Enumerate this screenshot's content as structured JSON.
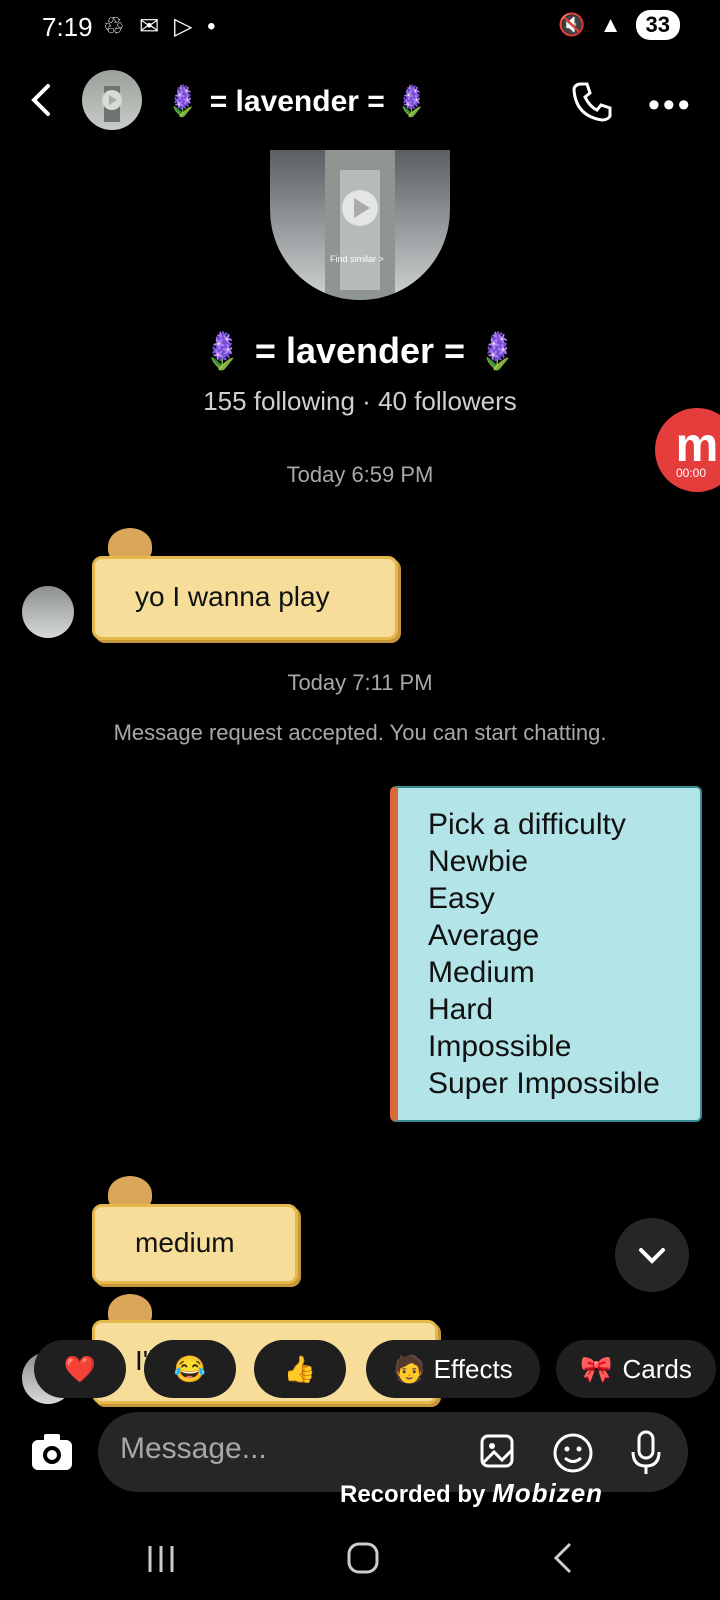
{
  "status": {
    "time": "7:19",
    "battery": "33"
  },
  "header": {
    "title": "🪻 = lavender = 🪻"
  },
  "profile": {
    "name": "🪻 = lavender = 🪻",
    "stats": "155 following · 40 followers",
    "avatar_overlay": "Find similar >"
  },
  "messages": {
    "ts1": "Today 6:59 PM",
    "msg1": "yo I wanna play",
    "ts2": "Today 7:11 PM",
    "system": "Message request accepted. You can start chatting.",
    "menu": [
      "Pick a difficulty",
      "Newbie",
      "Easy",
      "Average",
      "Medium",
      "Hard",
      "Impossible",
      "Super Impossible"
    ],
    "msg2": "medium",
    "msg3_partial": "I'll play"
  },
  "quick_actions": {
    "effects": "Effects",
    "cards": "Cards"
  },
  "composer": {
    "placeholder": "Message..."
  },
  "overlay": {
    "recorded_by": "Recorded by",
    "brand": "Mobizen",
    "rec_time": "00:00"
  },
  "icons": [
    "back-icon",
    "phone-icon",
    "more-icon",
    "camera-icon",
    "gallery-icon",
    "sticker-icon",
    "mic-icon",
    "chevron-down-icon",
    "heart-icon",
    "laugh-icon",
    "thumbs-up-icon"
  ],
  "colors": {
    "bubble_left": "#f6dd9a",
    "bubble_right": "#b2e4e8",
    "accent_record": "#e53c3c"
  }
}
